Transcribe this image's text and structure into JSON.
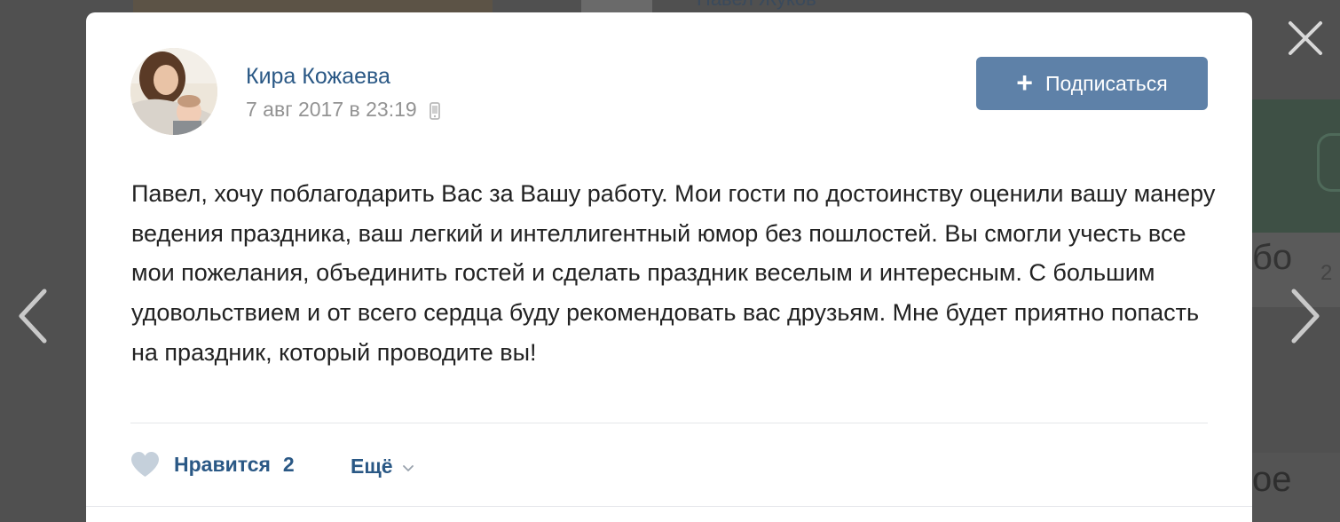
{
  "background": {
    "top_name": "Павел Жуков",
    "right_text": "бо",
    "right_text_small": "2",
    "right_bottom_text": "ое"
  },
  "post": {
    "author_name": "Кира Кожаева",
    "date": "7 авг 2017 в 23:19",
    "device_icon": "phone-icon",
    "text": "Павел, хочу поблагодарить Вас за Вашу работу. Мои гости по достоинству оценили вашу манеру ведения праздника, ваш легкий и интеллигентный юмор без пошлостей. Вы смогли учесть все мои пожелания, объединить гостей и сделать праздник веселым и интересным. С большим удовольствием и от всего сердца буду рекомендовать вас друзьям. Мне будет приятно попасть на праздник, который проводите вы!"
  },
  "actions": {
    "subscribe_label": "Подписаться",
    "subscribe_icon": "plus-icon",
    "like_label": "Нравится",
    "like_count": "2",
    "like_icon": "heart-icon",
    "more_label": "Ещё",
    "more_icon": "chevron-down-icon"
  },
  "colors": {
    "accent": "#2a5885",
    "button_bg": "#5e81a8",
    "muted": "#939393",
    "overlay": "#505050"
  }
}
